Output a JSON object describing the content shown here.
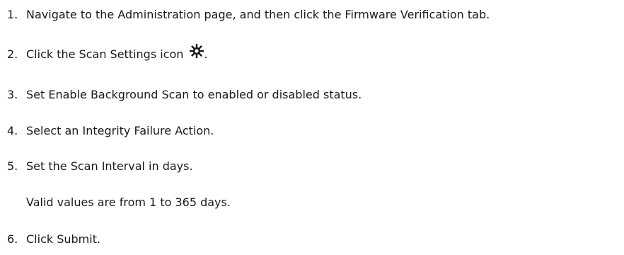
{
  "steps": [
    {
      "number": "1.",
      "text": "Navigate to the Administration page, and then click the  Firmware Verification tab."
    },
    {
      "number": "2.",
      "text": "Click the Scan Settings icon",
      "icon": "gear-icon",
      "suffix": "."
    },
    {
      "number": "3.",
      "text": "Set Enable Background Scan to enabled or disabled status."
    },
    {
      "number": "4.",
      "text": "Select an Integrity Failure Action."
    },
    {
      "number": "5.",
      "text": "Set the Scan Interval in days."
    },
    {
      "number": "6.",
      "text": "Click Submit."
    }
  ],
  "step5_note": "Valid values are from 1 to 365 days."
}
